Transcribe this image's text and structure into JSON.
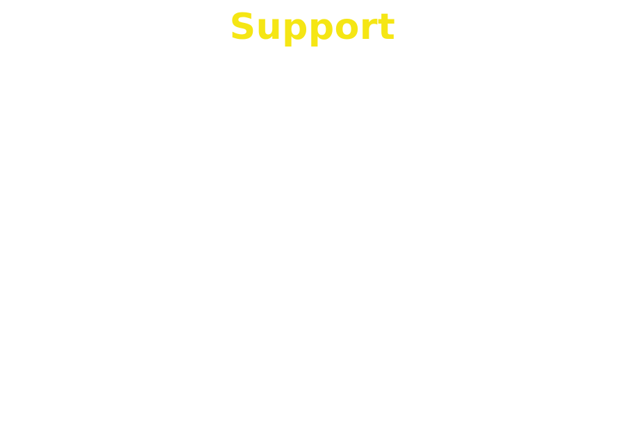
{
  "page": {
    "title": "Support",
    "title_color": "#f5e614",
    "background_color": "#ffffff"
  }
}
